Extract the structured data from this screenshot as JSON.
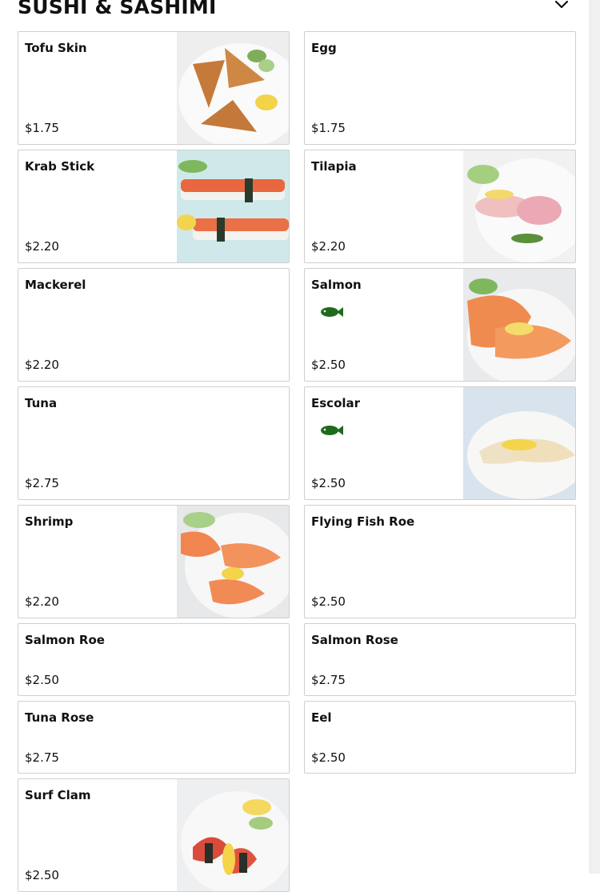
{
  "section": {
    "title": "SUSHI & SASHIMI",
    "toggle_icon": "chevron-down-icon"
  },
  "items": [
    {
      "name": "Tofu Skin",
      "price": "$1.75",
      "image": "tofu-skin-photo",
      "badge": ""
    },
    {
      "name": "Egg",
      "price": "$1.75",
      "image": "",
      "badge": ""
    },
    {
      "name": "Krab Stick",
      "price": "$2.20",
      "image": "krab-stick-photo",
      "badge": ""
    },
    {
      "name": "Tilapia",
      "price": "$2.20",
      "image": "tilapia-photo",
      "badge": ""
    },
    {
      "name": "Mackerel",
      "price": "$2.20",
      "image": "",
      "badge": ""
    },
    {
      "name": "Salmon",
      "price": "$2.50",
      "image": "salmon-photo",
      "badge": "fish-icon"
    },
    {
      "name": "Tuna",
      "price": "$2.75",
      "image": "",
      "badge": ""
    },
    {
      "name": "Escolar",
      "price": "$2.50",
      "image": "escolar-photo",
      "badge": "fish-icon"
    },
    {
      "name": "Shrimp",
      "price": "$2.20",
      "image": "shrimp-photo",
      "badge": ""
    },
    {
      "name": "Flying Fish Roe",
      "price": "$2.50",
      "image": "",
      "badge": ""
    },
    {
      "name": "Salmon Roe",
      "price": "$2.50",
      "image": "",
      "badge": ""
    },
    {
      "name": "Salmon Rose",
      "price": "$2.75",
      "image": "",
      "badge": ""
    },
    {
      "name": "Tuna Rose",
      "price": "$2.75",
      "image": "",
      "badge": ""
    },
    {
      "name": "Eel",
      "price": "$2.50",
      "image": "",
      "badge": ""
    },
    {
      "name": "Surf Clam",
      "price": "$2.50",
      "image": "surf-clam-photo",
      "badge": ""
    }
  ],
  "colors": {
    "fish_badge": "#1e6b1e",
    "border": "#cfcfcf"
  }
}
